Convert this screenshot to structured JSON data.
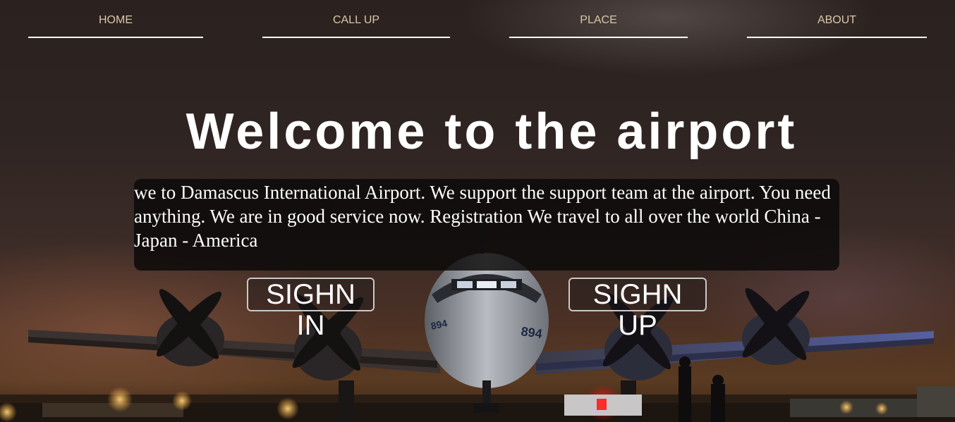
{
  "nav": {
    "items": [
      {
        "label": "HOME"
      },
      {
        "label": "CALL UP"
      },
      {
        "label": "PLACE"
      },
      {
        "label": "ABOUT"
      }
    ]
  },
  "hero": {
    "title": "Welcome to the airport",
    "intro": "we to Damascus International Airport. We support the support team at the airport. You need anything. We are in good service now. Registration We travel to all over the world China - Japan - America",
    "signin_label": "SIGHN IN",
    "signup_label": "SIGHN UP",
    "aircraft_marking": "894"
  },
  "colors": {
    "nav_text": "#d9c7a8",
    "nav_underline": "#ffffff",
    "title": "#ffffff",
    "intro_background": "#0a0808",
    "button_border": "#c9c9c9"
  }
}
